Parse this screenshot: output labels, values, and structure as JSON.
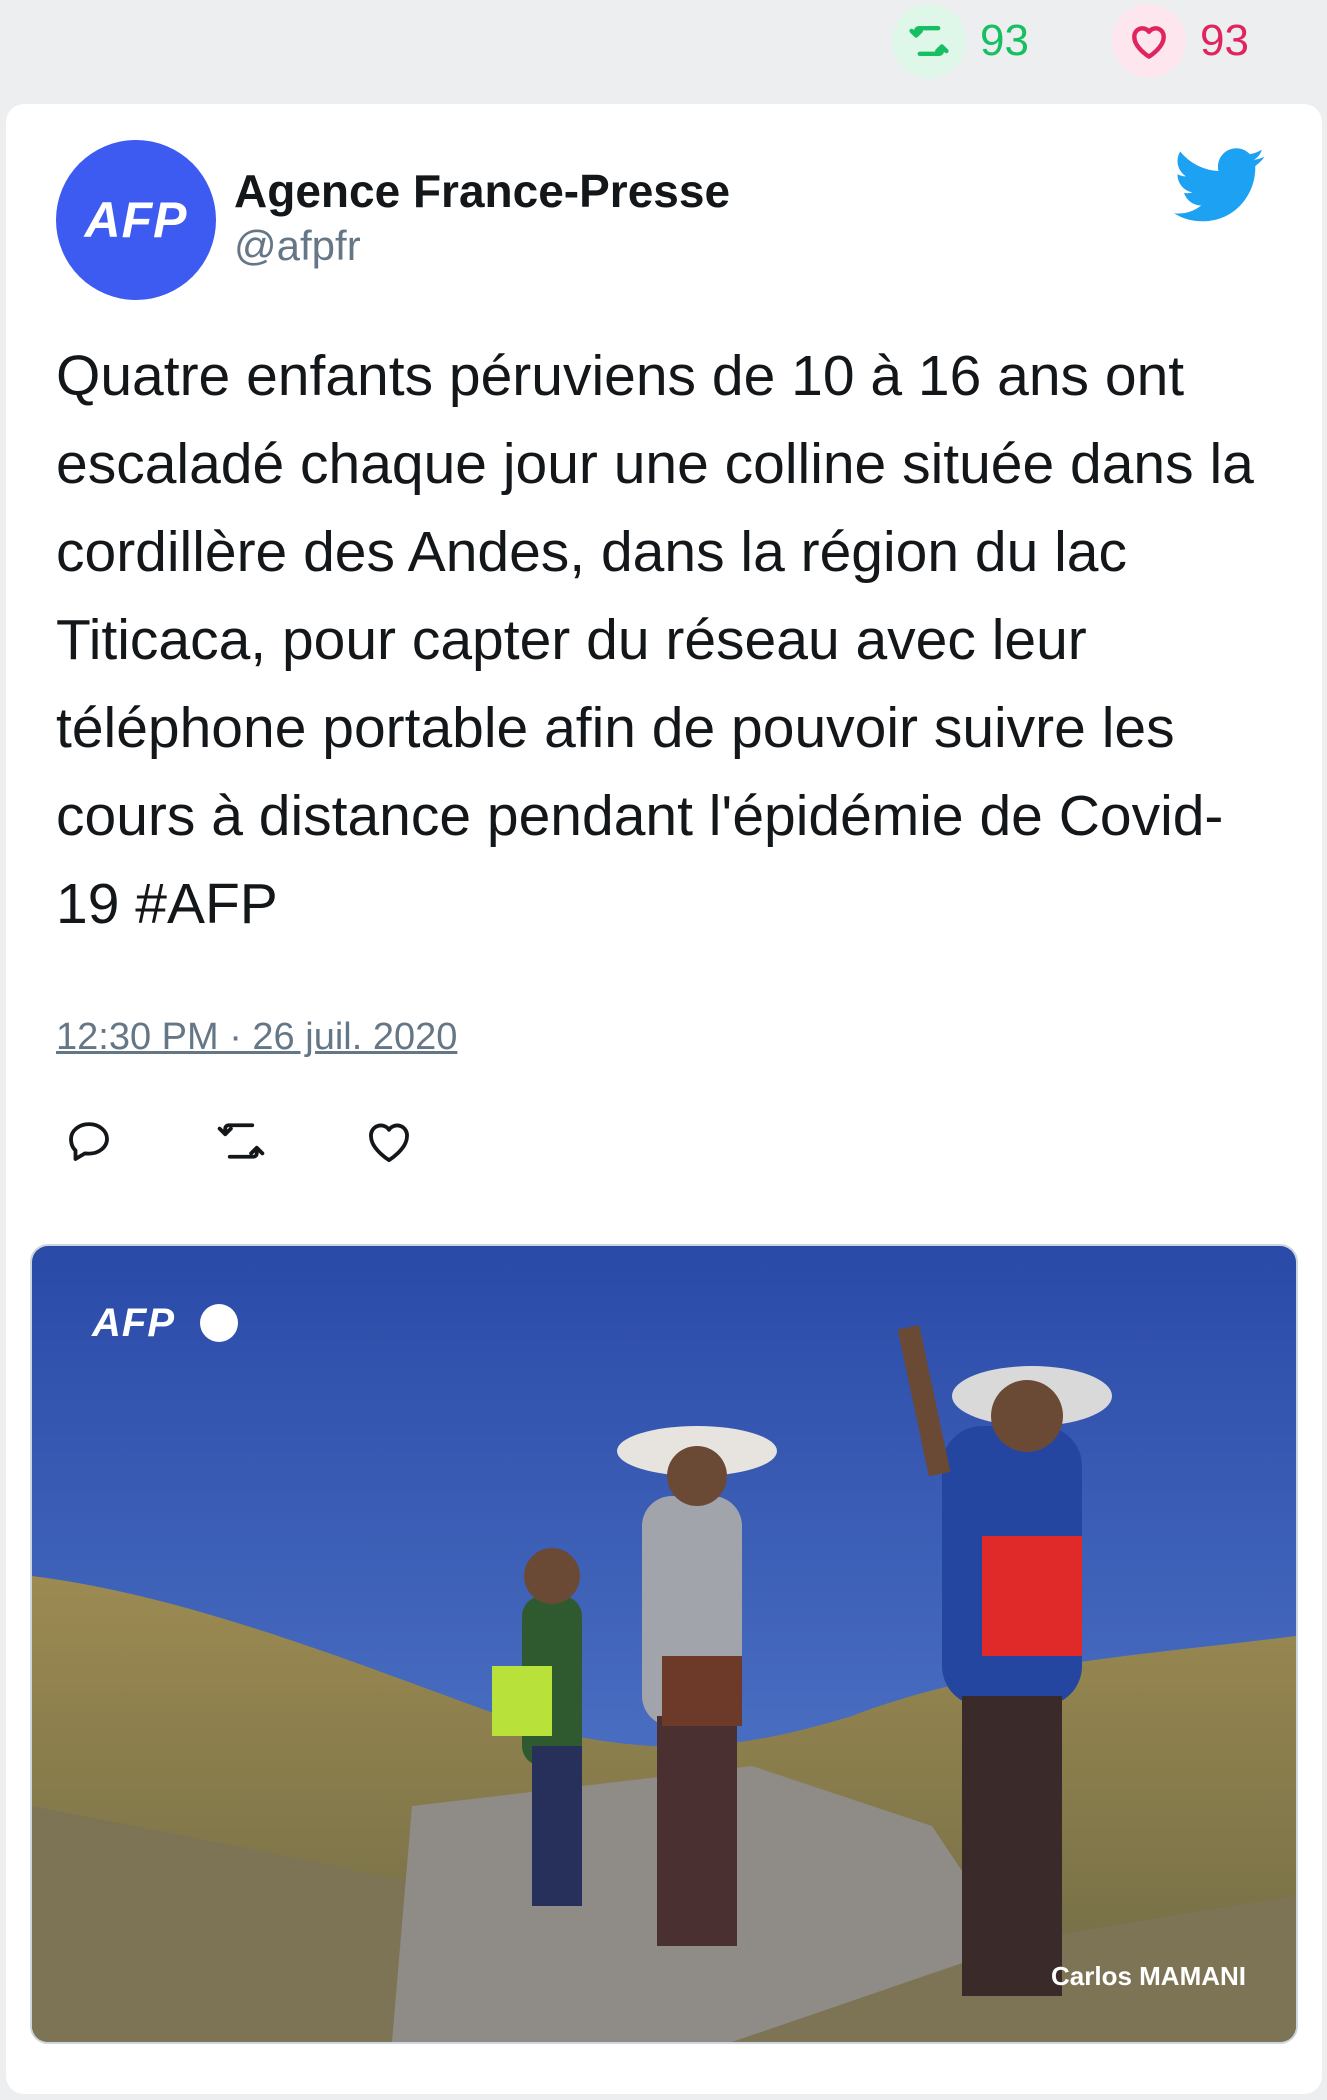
{
  "stats": {
    "retweet_count": "93",
    "like_count": "93"
  },
  "tweet": {
    "avatar_text": "AFP",
    "author_name": "Agence France-Presse",
    "author_handle": "@afpfr",
    "text": "Quatre enfants péruviens de 10 à 16 ans ont escaladé chaque jour une colline située dans la cordillère des Andes, dans la région du lac Titicaca, pour capter du réseau avec leur téléphone portable afin de pouvoir suivre les cours à distance pendant l'épidémie de Covid-19 #AFP",
    "timestamp": "12:30 PM · 26 juil. 2020"
  },
  "media": {
    "watermark": "AFP",
    "credit": "Carlos MAMANI"
  },
  "icons": {
    "retweet": "retweet-icon",
    "like": "heart-icon",
    "reply": "reply-icon",
    "brand": "twitter-bird-icon"
  },
  "colors": {
    "retweet_green": "#17bf63",
    "like_red": "#e0245e",
    "avatar_blue": "#3d5af1",
    "twitter_blue": "#1da1f2",
    "handle_gray": "#657786"
  }
}
